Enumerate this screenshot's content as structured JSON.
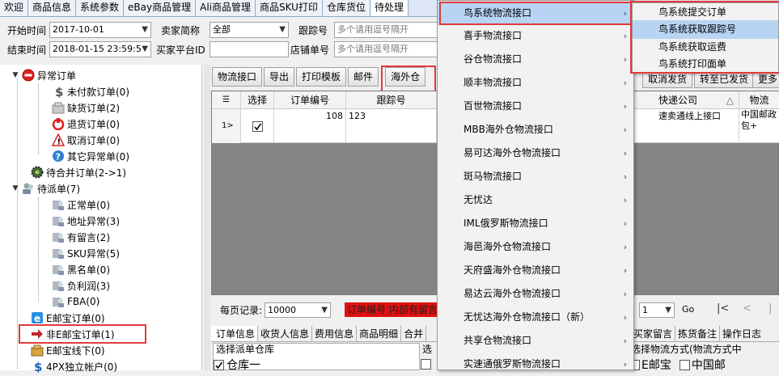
{
  "tabs": [
    "欢迎",
    "商品信息",
    "系统参数",
    "eBay商品管理",
    "Ali商品管理",
    "商品SKU打印",
    "仓库货位",
    "待处理"
  ],
  "filters": {
    "start_label": "开始时间",
    "start_value": "2017-10-01",
    "end_label": "结束时间",
    "end_value": "2018-01-15 23:59:5",
    "seller_label": "卖家简称",
    "seller_value": "全部",
    "buyer_label": "买家平台ID",
    "buyer_value": "",
    "tracking_label": "跟踪号",
    "tracking_placeholder": "多个请用逗号隔开",
    "store_label": "店铺单号",
    "store_placeholder": "多个请用逗号隔开"
  },
  "tree": [
    {
      "label": "异常订单",
      "icon": "no-entry-icon"
    },
    {
      "label": "未付款订单(0)",
      "icon": "dollar-icon"
    },
    {
      "label": "缺货订单(2)",
      "icon": "box-icon"
    },
    {
      "label": "退货订单(0)",
      "icon": "return-icon"
    },
    {
      "label": "取消订单(0)",
      "icon": "warning-icon"
    },
    {
      "label": "其它异常单(0)",
      "icon": "question-icon"
    },
    {
      "label": "待合并订单(2->1)",
      "icon": "gear-icon"
    },
    {
      "label": "待派单(7)",
      "icon": "users-icon"
    },
    {
      "label": "正常单(0)",
      "icon": "user-icon"
    },
    {
      "label": "地址异常(3)",
      "icon": "user-icon"
    },
    {
      "label": "有留言(2)",
      "icon": "user-icon"
    },
    {
      "label": "SKU异常(5)",
      "icon": "user-icon"
    },
    {
      "label": "黑名单(0)",
      "icon": "user-icon"
    },
    {
      "label": "负利润(3)",
      "icon": "user-icon"
    },
    {
      "label": "FBA(0)",
      "icon": "user-icon"
    },
    {
      "label": "E邮宝订单(0)",
      "icon": "e-icon"
    },
    {
      "label": "非E邮宝订单(1)",
      "icon": "arrow-icon"
    },
    {
      "label": "E邮宝线下(0)",
      "icon": "box-icon"
    },
    {
      "label": "4PX独立帐户(0)",
      "icon": "dollar-icon"
    }
  ],
  "toolbar": [
    "物流接口",
    "导出",
    "打印模板",
    "邮件",
    "海外仓"
  ],
  "right_buttons": [
    "取消发货",
    "转至已发货",
    "更多"
  ],
  "grid": {
    "headers": [
      "选择",
      "订单编号",
      "跟踪号"
    ],
    "row_marker": "1>",
    "order_no": "108",
    "tracking": "123",
    "right_headers": [
      "快递公司",
      "物流"
    ],
    "carrier": "速卖通线上接口",
    "logistics": "中国邮政包+"
  },
  "pager": {
    "label": "每页记录:",
    "value": "10000",
    "page": "1",
    "go": "Go"
  },
  "warn_text": "订单编号 内部有留言",
  "bottom_tabs": [
    "订单信息",
    "收货人信息",
    "费用信息",
    "商品明细",
    "合并"
  ],
  "bottom_tabs_right": [
    "买家留言",
    "拣货备注",
    "操作日志"
  ],
  "warehouse": {
    "label": "选择派单仓库",
    "item": "仓库一"
  },
  "shipping_method": {
    "label": "选择物流方式(物流方式中",
    "items": [
      "E邮宝",
      "中国邮"
    ]
  },
  "select_label": "选",
  "menu": [
    "鸟系统物流接口",
    "喜手物流接口",
    "谷仓物流接口",
    "顺丰物流接口",
    "百世物流接口",
    "MBB海外仓物流接口",
    "易可达海外仓物流接口",
    "斑马物流接口",
    "无忧达",
    "IML俄罗斯物流接口",
    "海邑海外仓物流接口",
    "天府盛海外仓物流接口",
    "易达云海外仓物流接口",
    "无忧达海外仓物流接口（新）",
    "共享仓物流接口",
    "实速通俄罗斯物流接口"
  ],
  "submenu": [
    "鸟系统提交订单",
    "鸟系统获取跟踪号",
    "鸟系统获取运费",
    "鸟系统打印面单"
  ],
  "colors": {
    "highlight": "#b7d4f3",
    "redbox": "#e23a3a",
    "grid_dark": "#848484"
  }
}
